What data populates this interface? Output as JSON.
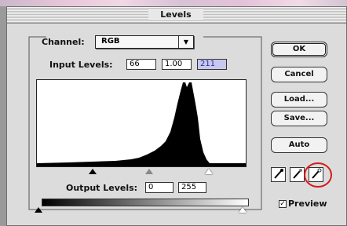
{
  "window": {
    "title": "Levels"
  },
  "channel": {
    "label": "Channel:",
    "value": "RGB"
  },
  "input_levels": {
    "label": "Input Levels:",
    "black": "66",
    "gamma": "1.00",
    "white": "211"
  },
  "output_levels": {
    "label": "Output Levels:",
    "black": "0",
    "white": "255"
  },
  "buttons": {
    "ok": "OK",
    "cancel": "Cancel",
    "load": "Load...",
    "save": "Save...",
    "auto": "Auto"
  },
  "preview": {
    "label": "Preview",
    "checked": true
  },
  "icons": {
    "channel_dropdown": "chevron-down-icon",
    "black_eyedropper": "eyedropper-black-icon",
    "gray_eyedropper": "eyedropper-gray-icon",
    "white_eyedropper": "eyedropper-white-icon"
  },
  "colors": {
    "annotation": "#d71a1a",
    "selected_field": "#c8c8ee"
  }
}
